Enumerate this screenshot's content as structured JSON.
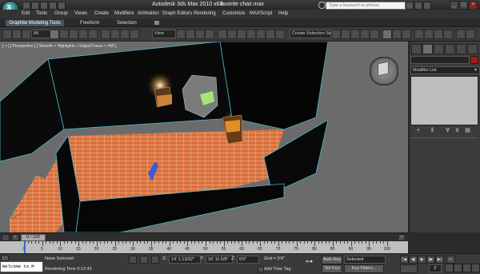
{
  "window": {
    "app_title": "Autodesk 3ds Max  2010 x64",
    "file_title": "favorite chair.max",
    "search_placeholder": "Type a keyword or phrase",
    "min_label": "_",
    "max_label": "□",
    "close_label": "×"
  },
  "menu": [
    "Edit",
    "Tools",
    "Group",
    "Views",
    "Create",
    "Modifiers",
    "Animation",
    "Graph Editors",
    "Rendering",
    "Customize",
    "MAXScript",
    "Help"
  ],
  "ribbon": {
    "tabs": [
      "Graphite Modeling Tools",
      "Freeform",
      "Selection"
    ],
    "active_tab": "Graphite Modeling Tools"
  },
  "toolbar": {
    "selection_filter": "All",
    "coord_system": "View",
    "named_selection_placeholder": "Create Selection Se"
  },
  "viewport": {
    "label": "[ + ] [ Perspective ] [ Smooth + Highlights + Edged Faces + HW ]"
  },
  "command_panel": {
    "modifier_list": "Modifier List",
    "object_color": "#b01515"
  },
  "timeline": {
    "slider_label": "0 / 100",
    "current_frame": 0,
    "total_frames": 100,
    "ticks": [
      "0",
      "5",
      "10",
      "15",
      "20",
      "25",
      "30",
      "35",
      "40",
      "45",
      "50",
      "55",
      "60",
      "65",
      "70",
      "75",
      "80",
      "85",
      "90",
      "95",
      "100"
    ]
  },
  "status": {
    "maxscript_text": "Welcome to M",
    "selection_msg": "None Selected",
    "render_time": "Rendering Time  0:12:43",
    "x_label": "X:",
    "x_value": "14' 1 13/32\"",
    "y_label": "Y:",
    "y_value": "16' 11 5/8\"",
    "z_label": "Z:",
    "z_value": "0'0\"",
    "grid": "Grid = 0'4\"",
    "add_time_tag": "Add Time Tag",
    "auto_key": "Auto Key",
    "set_key": "Set Key",
    "key_mode": "Selected",
    "key_filters": "Key Filters...",
    "frame": "0"
  }
}
